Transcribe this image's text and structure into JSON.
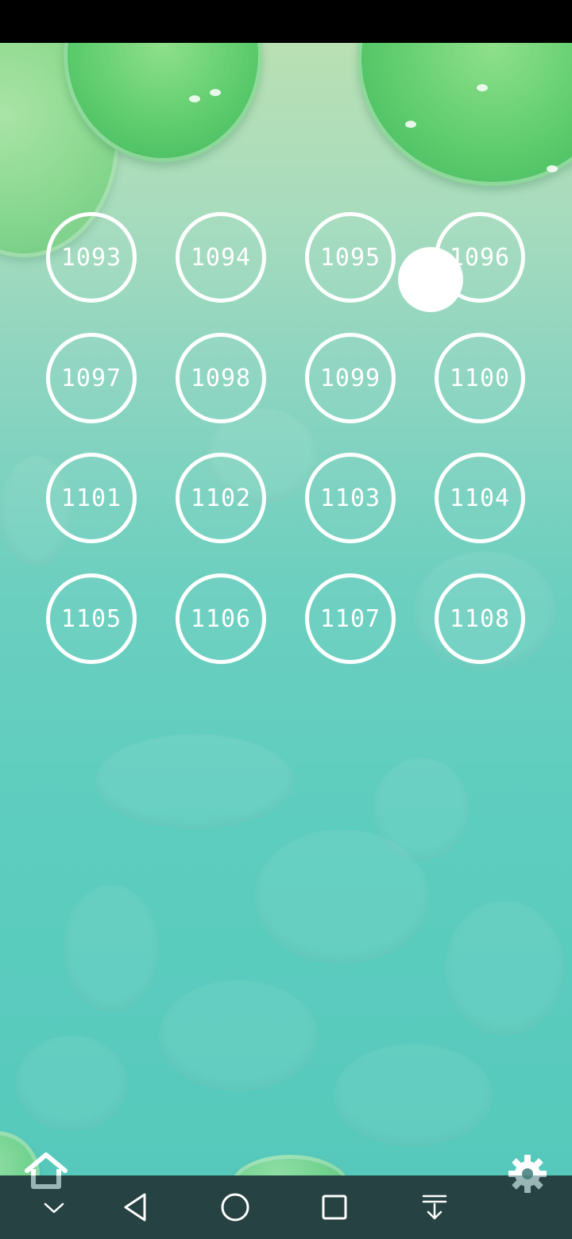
{
  "levels": [
    "1093",
    "1094",
    "1095",
    "1096",
    "1097",
    "1098",
    "1099",
    "1100",
    "1101",
    "1102",
    "1103",
    "1104",
    "1105",
    "1106",
    "1107",
    "1108"
  ],
  "icons": {
    "home": "home-icon",
    "settings": "gear-icon",
    "nav": [
      "chevron-down-icon",
      "back-icon",
      "home-circle-icon",
      "recents-icon",
      "download-icon"
    ]
  },
  "colors": {
    "ring": "#ffffff",
    "water_top": "#b9e0b3",
    "water_bottom": "#57c9bc",
    "lily_pad": "#5dcc6d"
  }
}
